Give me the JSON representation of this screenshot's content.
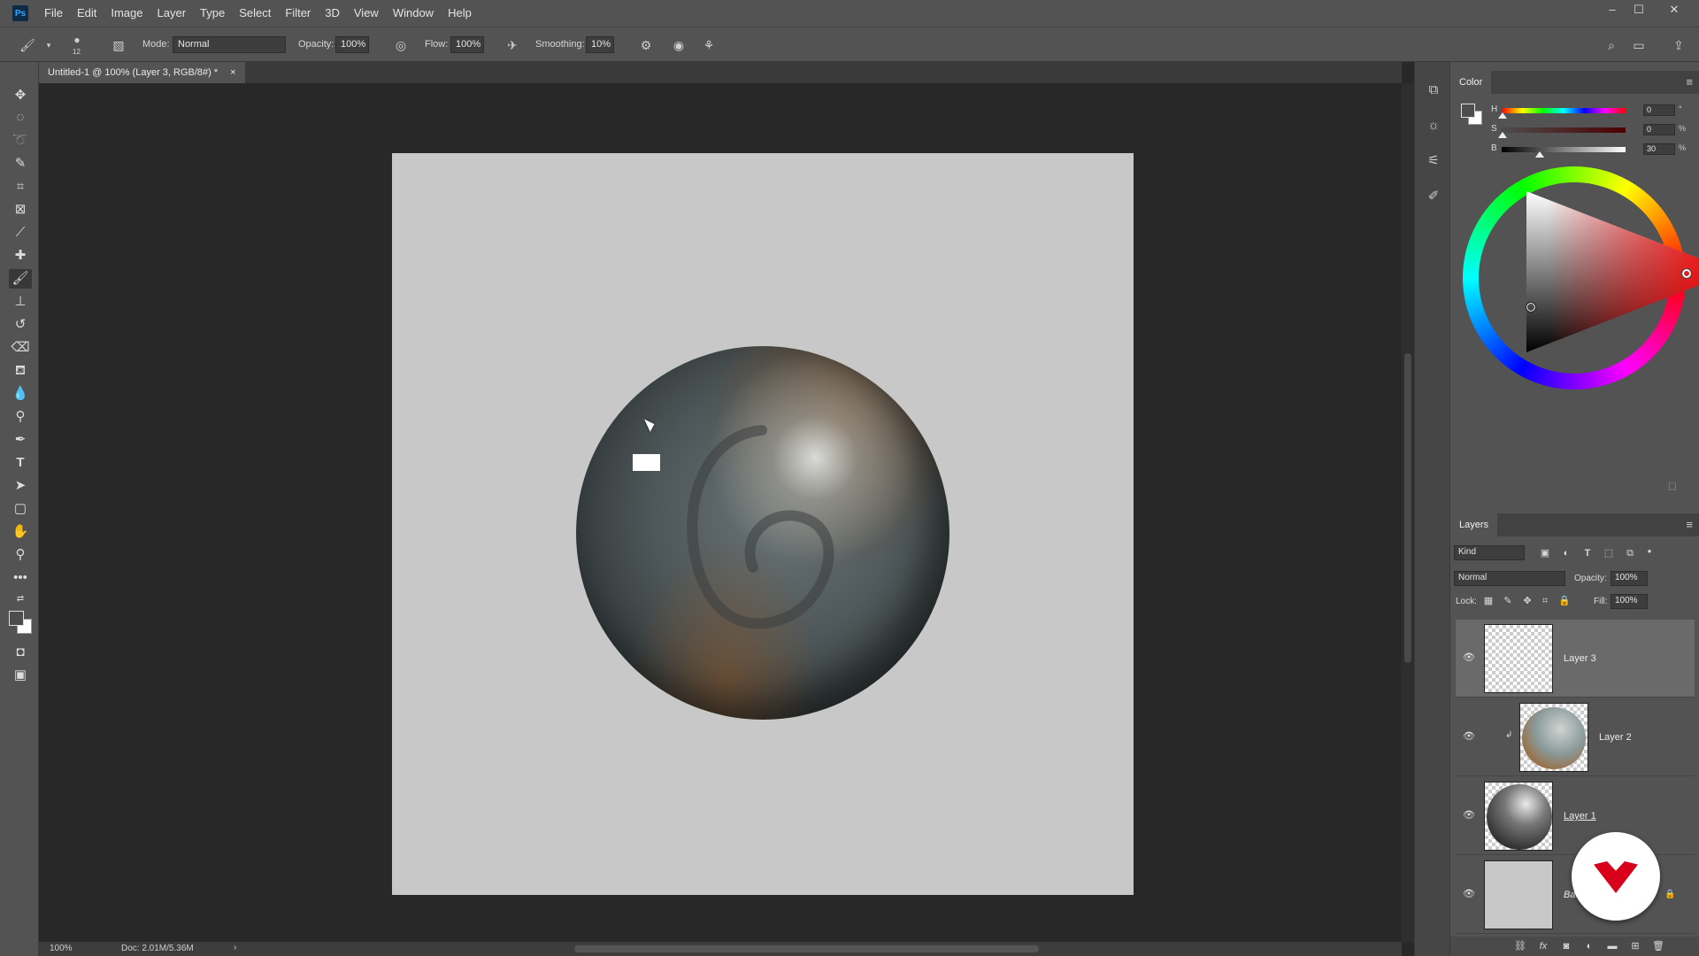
{
  "app": {
    "logo": "Ps"
  },
  "menubar": {
    "items": [
      "File",
      "Edit",
      "Image",
      "Layer",
      "Type",
      "Select",
      "Filter",
      "3D",
      "View",
      "Window",
      "Help"
    ]
  },
  "window_controls": {
    "minimize": "–",
    "maximize": "☐",
    "close": "✕"
  },
  "options_bar": {
    "brush_size": "12",
    "mode_label": "Mode:",
    "mode_value": "Normal",
    "opacity_label": "Opacity:",
    "opacity_value": "100%",
    "flow_label": "Flow:",
    "flow_value": "100%",
    "smoothing_label": "Smoothing:",
    "smoothing_value": "10%"
  },
  "document_tab": {
    "title": "Untitled-1 @ 100% (Layer 3, RGB/8#) *",
    "close": "×"
  },
  "status_bar": {
    "zoom": "100%",
    "doc_info": "Doc: 2.01M/5.36M"
  },
  "color_panel": {
    "title": "Color",
    "h_label": "H",
    "h_value": "0",
    "h_unit": "°",
    "s_label": "S",
    "s_value": "0",
    "s_unit": "%",
    "b_label": "B",
    "b_value": "30",
    "b_unit": "%",
    "foreground_color": "#4d4d4d",
    "background_color": "#ffffff"
  },
  "layers_panel": {
    "title": "Layers",
    "filter_kind": "Kind",
    "blend_mode": "Normal",
    "opacity_label": "Opacity:",
    "opacity_value": "100%",
    "lock_label": "Lock:",
    "fill_label": "Fill:",
    "fill_value": "100%",
    "layers": [
      {
        "name": "Layer 3",
        "selected": true
      },
      {
        "name": "Layer 2",
        "selected": false,
        "clipped": true
      },
      {
        "name": "Layer 1",
        "selected": false
      },
      {
        "name": "Background",
        "selected": false,
        "locked": true
      }
    ]
  },
  "colors": {
    "accent": "#31a8ff",
    "watermark": "#d9001b"
  }
}
